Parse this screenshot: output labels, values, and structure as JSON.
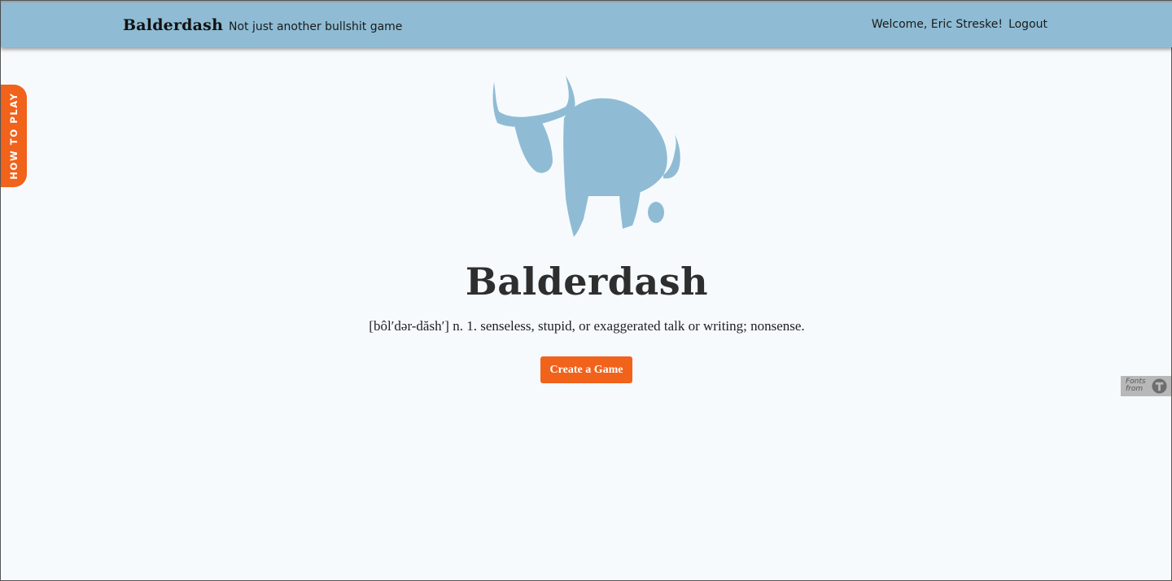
{
  "navbar": {
    "brand": "Balderdash",
    "tagline": "Not just another bullshit game",
    "welcome": "Welcome, Eric Streske!",
    "logout": "Logout"
  },
  "side_tab": {
    "label": "HOW TO PLAY"
  },
  "hero": {
    "logo_icon": "bull-logo-icon",
    "title": "Balderdash",
    "definition": "[bôl′dər-dăsh′] n. 1. senseless, stupid, or exaggerated talk or writing; nonsense.",
    "create_button": "Create a Game"
  },
  "badge": {
    "text": "Fonts from",
    "icon": "typekit-icon"
  },
  "colors": {
    "navbar": "#8fbcd4",
    "accent": "#f1621b",
    "logo": "#8fbcd4",
    "background": "#f6fafd"
  }
}
